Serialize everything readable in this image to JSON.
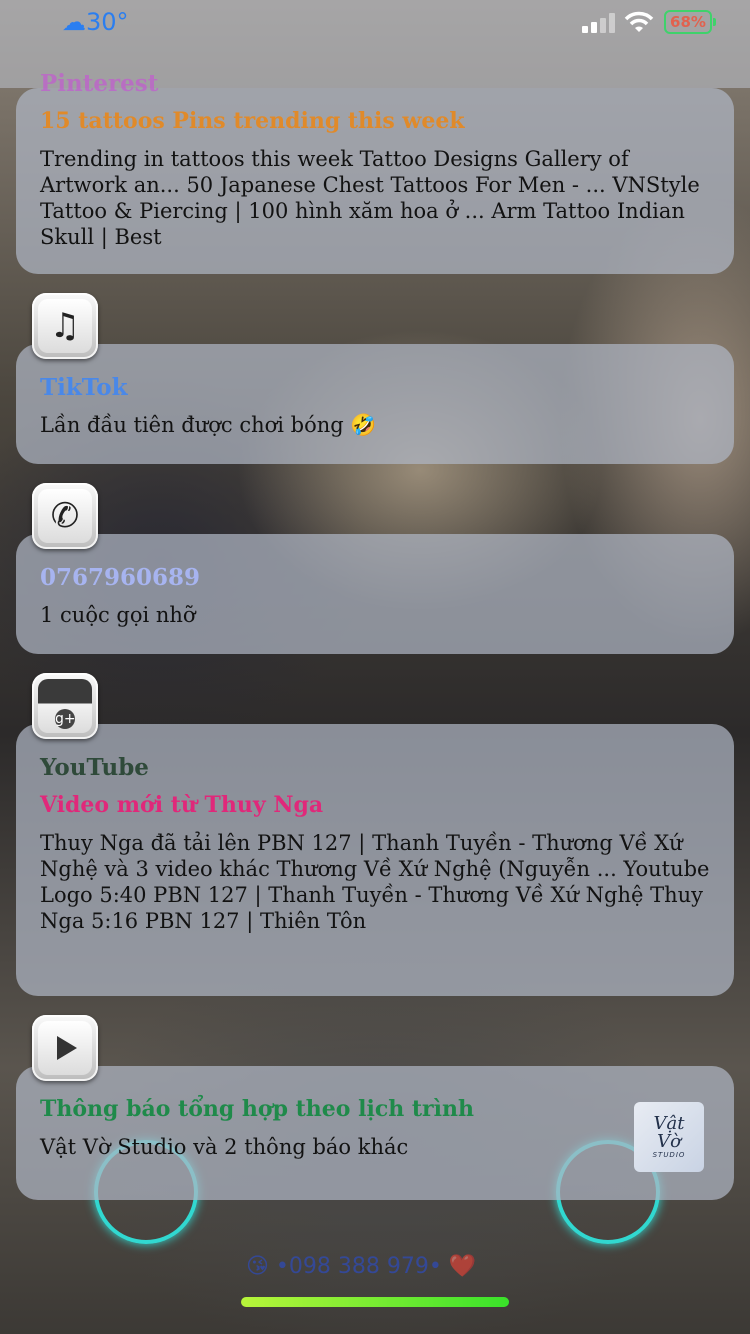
{
  "status": {
    "weather_icon": "cloud-icon",
    "temperature": "30°",
    "battery": "68%",
    "battery_color": "#3fd26b"
  },
  "notifications": [
    {
      "app": "Pinterest",
      "app_color": "#c94fd8",
      "title": "15 tattoos Pins trending this week",
      "title_color": "#e08a2a",
      "body": "Trending in tattoos this week Tattoo Designs Gallery of Artwork an... 50 Japanese Chest Tattoos For Men - ... VNStyle Tattoo & Piercing | 100 hình xăm hoa ở ... Arm Tattoo Indian Skull | Best"
    },
    {
      "app": "TikTok",
      "app_color": "#4a88e8",
      "icon": "music-notes-icon",
      "body": "Lần đầu tiên được chơi bóng 🤣"
    },
    {
      "app": "0767960689",
      "app_color": "#a7b4f0",
      "icon": "phone-icon",
      "body": "1 cuộc gọi nhỡ"
    },
    {
      "app": "YouTube",
      "app_color": "#2f4a3a",
      "icon": "google-plus-icon",
      "title": "Video mới từ Thuy Nga",
      "title_color": "#e0287a",
      "body": "Thuy Nga đã tải lên PBN 127 | Thanh Tuyền - Thương Về Xứ Nghệ và 3 video khác Thương Về Xứ Nghệ (Nguyễn ... Youtube Logo 5:40 PBN 127 | Thanh Tuyền - Thương Về Xứ Nghệ Thuy Nga 5:16 PBN 127 | Thiên Tôn"
    },
    {
      "icon": "play-icon",
      "title": "Thông báo tổng hợp theo lịch trình",
      "title_color": "#1f8a4a",
      "body": "Vật Vờ Studio và 2 thông báo khác",
      "thumb_line1": "Vật",
      "thumb_line2": "Vờ",
      "thumb_line3": "STUDIO"
    }
  ],
  "footer": {
    "text": "😘 •098 388 979• ❤️"
  }
}
